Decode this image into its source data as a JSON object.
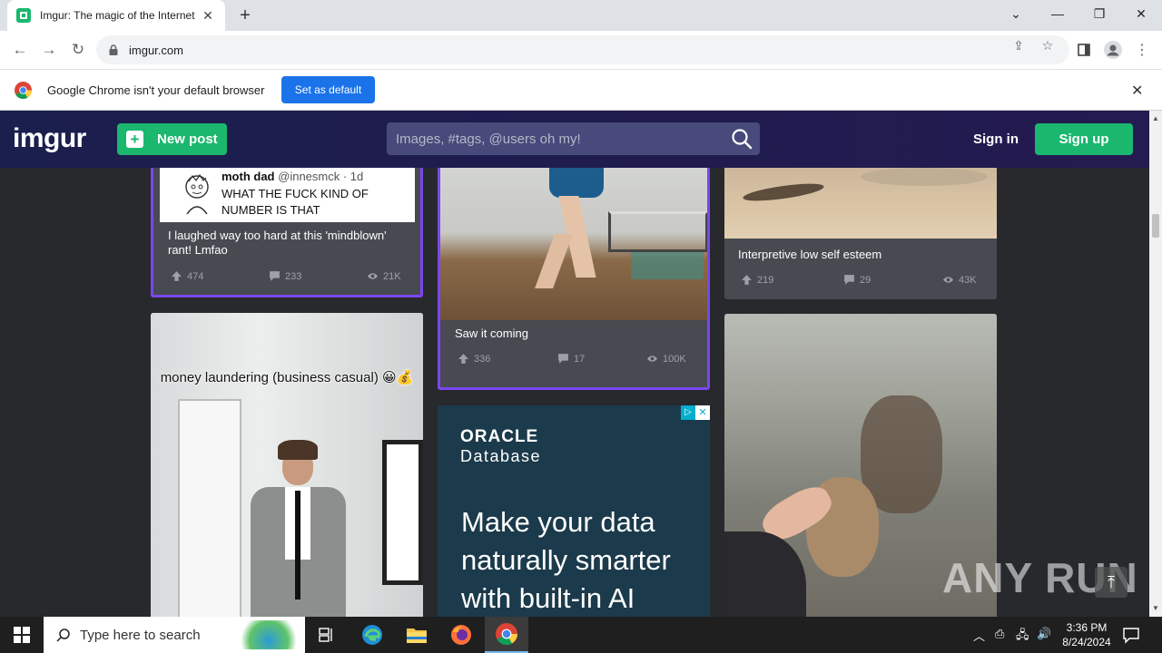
{
  "browser": {
    "tab_title": "Imgur: The magic of the Internet",
    "url": "imgur.com",
    "infobar_text": "Google Chrome isn't your default browser",
    "set_default_label": "Set as default"
  },
  "imgur": {
    "logo": "imgur",
    "new_post_label": "New post",
    "search_placeholder": "Images, #tags, @users oh my!",
    "sign_in_label": "Sign in",
    "sign_up_label": "Sign up"
  },
  "posts": [
    {
      "tweet_author": "moth dad",
      "tweet_handle": "@innesmck · 1d",
      "tweet_text": "WHAT THE FUCK KIND OF NUMBER IS THAT",
      "title": "I laughed way too hard at this 'mindblown' rant! Lmfao",
      "upvotes": "474",
      "comments": "233",
      "views": "21K"
    },
    {
      "title": "Saw it coming",
      "upvotes": "336",
      "comments": "17",
      "views": "100K"
    },
    {
      "title": "Interpretive low self esteem",
      "upvotes": "219",
      "comments": "29",
      "views": "43K"
    },
    {
      "caption": "money laundering (business casual) 😀💰"
    }
  ],
  "ad": {
    "brand_top": "ORACLE",
    "brand_bottom": "Database",
    "headline": "Make your data naturally smarter with built-in AI"
  },
  "watermark": "ANY RUN",
  "taskbar": {
    "search_placeholder": "Type here to search",
    "time": "3:36 PM",
    "date": "8/24/2024"
  }
}
